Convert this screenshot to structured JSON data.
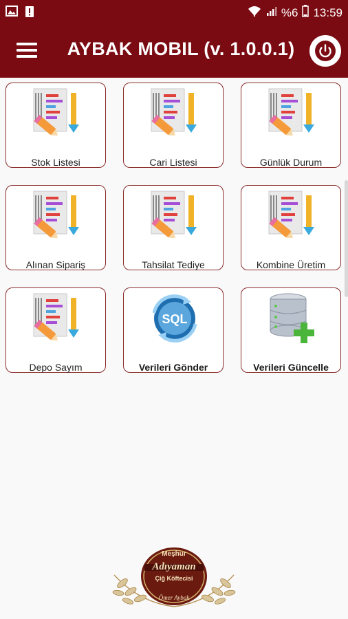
{
  "status_bar": {
    "battery_percent": "%6",
    "time": "13:59"
  },
  "app_bar": {
    "title": "AYBAK MOBIL (v. 1.0.0.1)"
  },
  "tiles": [
    {
      "label": "Stok Listesi",
      "icon": "list-edit-icon",
      "bold": false
    },
    {
      "label": "Cari Listesi",
      "icon": "list-edit-icon",
      "bold": false
    },
    {
      "label": "Günlük Durum",
      "icon": "list-edit-icon",
      "bold": false
    },
    {
      "label": "Alınan Sipariş",
      "icon": "list-edit-icon",
      "bold": false
    },
    {
      "label": "Tahsilat Tediye",
      "icon": "list-edit-icon",
      "bold": false
    },
    {
      "label": "Kombine Üretim",
      "icon": "list-edit-icon",
      "bold": false
    },
    {
      "label": "Depo Sayım",
      "icon": "list-edit-icon",
      "bold": false
    },
    {
      "label": "Verileri Gönder",
      "icon": "sql-sync-icon",
      "bold": true
    },
    {
      "label": "Verileri Güncelle",
      "icon": "database-add-icon",
      "bold": true
    }
  ],
  "logo": {
    "line1": "Meşhur",
    "line2": "Adıyaman",
    "line3": "Çiğ Köftecisi",
    "line4": "Ömer Aybak"
  },
  "colors": {
    "brand": "#7b0b12",
    "tile_border": "#8a2a2a"
  }
}
